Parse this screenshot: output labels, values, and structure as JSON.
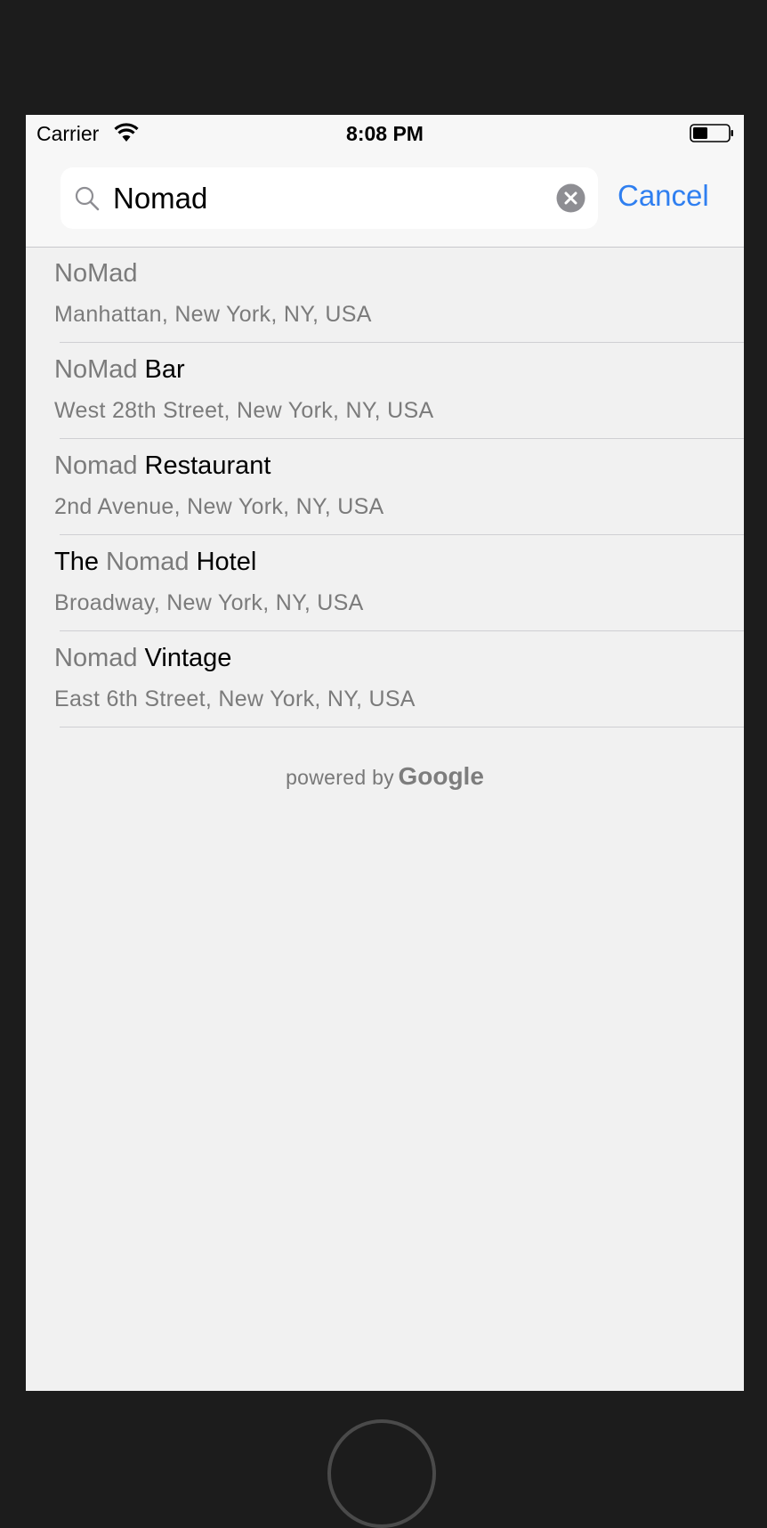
{
  "status_bar": {
    "carrier": "Carrier",
    "time": "8:08 PM"
  },
  "search": {
    "query": "Nomad",
    "cancel_label": "Cancel"
  },
  "results": [
    {
      "title_parts": [
        {
          "text": "NoMad",
          "match": true
        }
      ],
      "subtitle": "Manhattan, New York, NY, USA"
    },
    {
      "title_parts": [
        {
          "text": "NoMad",
          "match": true
        },
        {
          "text": " Bar",
          "match": false
        }
      ],
      "subtitle": "West 28th Street, New York, NY, USA"
    },
    {
      "title_parts": [
        {
          "text": "Nomad",
          "match": true
        },
        {
          "text": " Restaurant",
          "match": false
        }
      ],
      "subtitle": "2nd Avenue, New York, NY, USA"
    },
    {
      "title_parts": [
        {
          "text": "The ",
          "match": false
        },
        {
          "text": "Nomad",
          "match": true
        },
        {
          "text": " Hotel",
          "match": false
        }
      ],
      "subtitle": "Broadway, New York, NY, USA"
    },
    {
      "title_parts": [
        {
          "text": "Nomad",
          "match": true
        },
        {
          "text": " Vintage",
          "match": false
        }
      ],
      "subtitle": "East 6th Street, New York, NY, USA"
    }
  ],
  "attribution": {
    "prefix": "powered by",
    "brand": "Google"
  },
  "colors": {
    "accent": "#2f7ff0",
    "matched_text": "#7b7b7b",
    "device_frame": "#1c1c1c"
  },
  "icons": [
    "wifi-icon",
    "battery-icon",
    "search-icon",
    "clear-icon"
  ]
}
